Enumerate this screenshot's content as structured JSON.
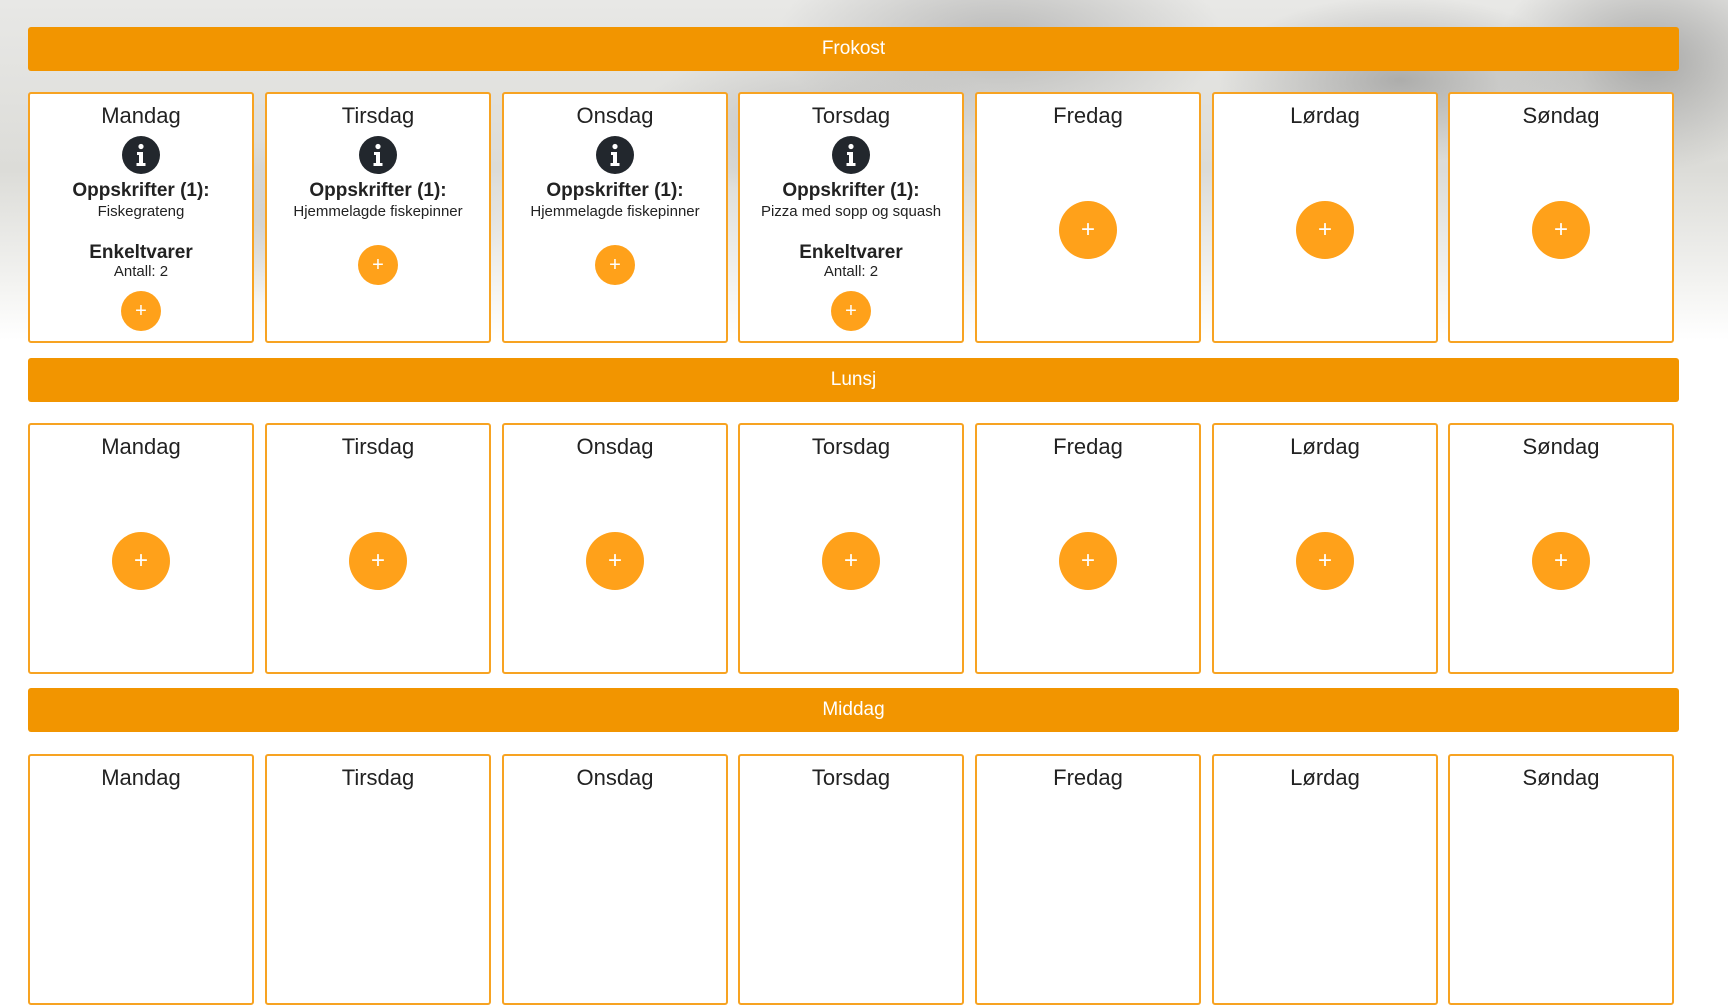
{
  "meals": [
    {
      "label": "Frokost",
      "days": [
        {
          "name": "Mandag",
          "recipes_label": "Oppskrifter (1):",
          "recipe": "Fiskegrateng",
          "items_label": "Enkeltvarer",
          "items_count": "Antall: 2"
        },
        {
          "name": "Tirsdag",
          "recipes_label": "Oppskrifter (1):",
          "recipe": "Hjemmelagde fiskepinner"
        },
        {
          "name": "Onsdag",
          "recipes_label": "Oppskrifter (1):",
          "recipe": "Hjemmelagde fiskepinner"
        },
        {
          "name": "Torsdag",
          "recipes_label": "Oppskrifter (1):",
          "recipe": "Pizza med sopp og squash",
          "items_label": "Enkeltvarer",
          "items_count": "Antall: 2"
        },
        {
          "name": "Fredag"
        },
        {
          "name": "Lørdag"
        },
        {
          "name": "Søndag"
        }
      ]
    },
    {
      "label": "Lunsj",
      "days": [
        {
          "name": "Mandag"
        },
        {
          "name": "Tirsdag"
        },
        {
          "name": "Onsdag"
        },
        {
          "name": "Torsdag"
        },
        {
          "name": "Fredag"
        },
        {
          "name": "Lørdag"
        },
        {
          "name": "Søndag"
        }
      ]
    },
    {
      "label": "Middag",
      "days": [
        {
          "name": "Mandag"
        },
        {
          "name": "Tirsdag"
        },
        {
          "name": "Onsdag"
        },
        {
          "name": "Torsdag"
        },
        {
          "name": "Fredag"
        },
        {
          "name": "Lørdag"
        },
        {
          "name": "Søndag"
        }
      ]
    }
  ],
  "add_label": "+",
  "icons": {
    "info": "info-icon",
    "add": "plus-icon"
  },
  "colors": {
    "accent": "#f29500",
    "button": "#ffa11a",
    "card_border": "#f7a322",
    "info_icon": "#22272d"
  }
}
